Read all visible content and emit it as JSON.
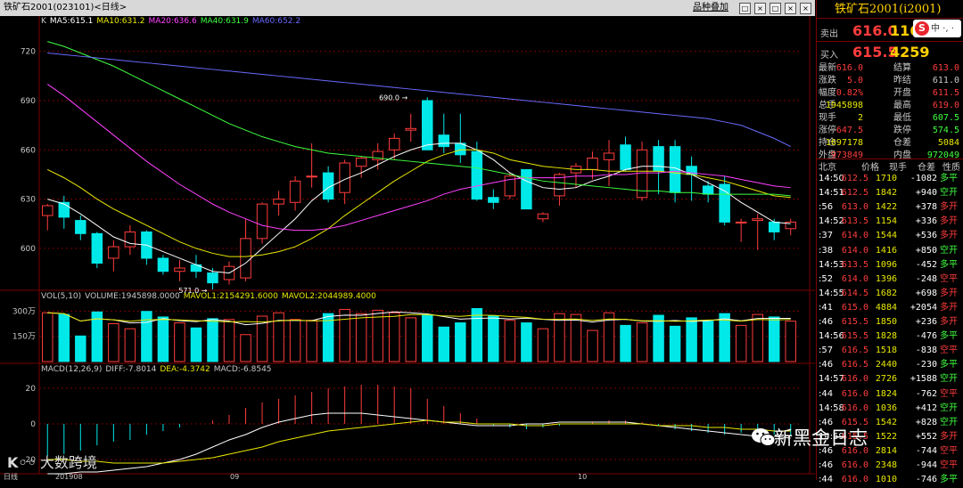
{
  "window": {
    "title": "铁矿石2001(023101)<日线>",
    "toolbar_label": "品种叠加",
    "buttons": [
      "□",
      "×",
      "□",
      "×",
      "×"
    ]
  },
  "ma_line": [
    {
      "text": "K",
      "color": "#c8c8c8"
    },
    {
      "text": "MA5:615.1",
      "color": "#ffffff"
    },
    {
      "text": "MA10:631.2",
      "color": "#e8e800"
    },
    {
      "text": "MA20:636.6",
      "color": "#ff40ff"
    },
    {
      "text": "MA40:631.9",
      "color": "#40ff40"
    },
    {
      "text": "MA60:652.2",
      "color": "#6a6aff"
    }
  ],
  "price_axis": [
    "720",
    "690",
    "660",
    "630",
    "600"
  ],
  "price_annotations": {
    "high": "690.0",
    "low": "571.0"
  },
  "vol_line": [
    {
      "text": "VOL(5,10)",
      "color": "#c8c8c8"
    },
    {
      "text": "VOLUME:1945898.0000",
      "color": "#c8c8c8"
    },
    {
      "text": "MAVOL1:2154291.6000",
      "color": "#e8e800"
    },
    {
      "text": "MAVOL2:2044989.4000",
      "color": "#e8e800"
    }
  ],
  "vol_axis": [
    "300万",
    "150万"
  ],
  "macd_line": [
    {
      "text": "MACD(12,26,9)",
      "color": "#c8c8c8"
    },
    {
      "text": "DIFF:-7.8014",
      "color": "#c8c8c8"
    },
    {
      "text": "DEA:-4.3742",
      "color": "#e8e800"
    },
    {
      "text": "MACD:-6.8545",
      "color": "#c8c8c8"
    }
  ],
  "macd_axis": [
    "20",
    "0",
    "-20"
  ],
  "date_axis": [
    "日线",
    "201908",
    "09",
    "10"
  ],
  "colors": {
    "up": "#ff3c3c",
    "down": "#00e8e8",
    "grid": "#7a0000",
    "neutral": "#c8c8c8"
  },
  "chart_data": {
    "type": "candlestick",
    "price_ylim": [
      575,
      735
    ],
    "candles": [
      {
        "o": 620,
        "h": 627,
        "l": 611,
        "c": 626
      },
      {
        "o": 628,
        "h": 632,
        "l": 612,
        "c": 619
      },
      {
        "o": 617,
        "h": 620,
        "l": 605,
        "c": 609
      },
      {
        "o": 609,
        "h": 610,
        "l": 588,
        "c": 591
      },
      {
        "o": 594,
        "h": 605,
        "l": 586,
        "c": 601
      },
      {
        "o": 601,
        "h": 614,
        "l": 596,
        "c": 610
      },
      {
        "o": 610,
        "h": 611,
        "l": 590,
        "c": 594
      },
      {
        "o": 594,
        "h": 596,
        "l": 584,
        "c": 586
      },
      {
        "o": 586,
        "h": 593,
        "l": 580,
        "c": 588
      },
      {
        "o": 590,
        "h": 596,
        "l": 582,
        "c": 586
      },
      {
        "o": 585,
        "h": 588,
        "l": 575,
        "c": 579
      },
      {
        "o": 581,
        "h": 592,
        "l": 578,
        "c": 589
      },
      {
        "o": 582,
        "h": 618,
        "l": 580,
        "c": 606
      },
      {
        "o": 606,
        "h": 628,
        "l": 603,
        "c": 627
      },
      {
        "o": 627,
        "h": 635,
        "l": 620,
        "c": 630
      },
      {
        "o": 628,
        "h": 644,
        "l": 623,
        "c": 641
      },
      {
        "o": 644,
        "h": 664,
        "l": 637,
        "c": 644
      },
      {
        "o": 646,
        "h": 650,
        "l": 628,
        "c": 630
      },
      {
        "o": 634,
        "h": 654,
        "l": 627,
        "c": 652
      },
      {
        "o": 650,
        "h": 656,
        "l": 643,
        "c": 655
      },
      {
        "o": 654,
        "h": 664,
        "l": 648,
        "c": 659
      },
      {
        "o": 660,
        "h": 670,
        "l": 654,
        "c": 667
      },
      {
        "o": 672,
        "h": 682,
        "l": 665,
        "c": 673
      },
      {
        "o": 690,
        "h": 692,
        "l": 660,
        "c": 660
      },
      {
        "o": 669,
        "h": 682,
        "l": 658,
        "c": 662
      },
      {
        "o": 664,
        "h": 682,
        "l": 652,
        "c": 657
      },
      {
        "o": 659,
        "h": 665,
        "l": 629,
        "c": 630
      },
      {
        "o": 631,
        "h": 636,
        "l": 624,
        "c": 628
      },
      {
        "o": 632,
        "h": 646,
        "l": 630,
        "c": 644
      },
      {
        "o": 648,
        "h": 648,
        "l": 624,
        "c": 624
      },
      {
        "o": 618,
        "h": 622,
        "l": 616,
        "c": 621
      },
      {
        "o": 632,
        "h": 646,
        "l": 626,
        "c": 645
      },
      {
        "o": 646,
        "h": 652,
        "l": 637,
        "c": 650
      },
      {
        "o": 648,
        "h": 659,
        "l": 642,
        "c": 655
      },
      {
        "o": 654,
        "h": 666,
        "l": 638,
        "c": 658
      },
      {
        "o": 663,
        "h": 668,
        "l": 647,
        "c": 648
      },
      {
        "o": 631,
        "h": 665,
        "l": 629,
        "c": 660
      },
      {
        "o": 662,
        "h": 666,
        "l": 633,
        "c": 647
      },
      {
        "o": 662,
        "h": 666,
        "l": 628,
        "c": 634
      },
      {
        "o": 650,
        "h": 656,
        "l": 629,
        "c": 645
      },
      {
        "o": 638,
        "h": 641,
        "l": 628,
        "c": 633
      },
      {
        "o": 639,
        "h": 644,
        "l": 614,
        "c": 616
      },
      {
        "o": 616,
        "h": 618,
        "l": 604,
        "c": 616
      },
      {
        "o": 617,
        "h": 621,
        "l": 599,
        "c": 618
      },
      {
        "o": 616,
        "h": 618,
        "l": 605,
        "c": 610
      },
      {
        "o": 612,
        "h": 618,
        "l": 608,
        "c": 616
      }
    ],
    "ma_lines": {
      "MA5": [
        630,
        627,
        621,
        614,
        607,
        603,
        602,
        598,
        594,
        590,
        586,
        585,
        591,
        600,
        609,
        618,
        629,
        637,
        642,
        646,
        651,
        656,
        660,
        663,
        664,
        664,
        660,
        654,
        646,
        641,
        637,
        636,
        637,
        641,
        644,
        648,
        650,
        650,
        649,
        645,
        640,
        635,
        628,
        622,
        616,
        615
      ],
      "MA10": [
        648,
        643,
        637,
        630,
        624,
        619,
        614,
        609,
        604,
        600,
        597,
        595,
        595,
        596,
        598,
        601,
        606,
        612,
        620,
        627,
        634,
        641,
        647,
        653,
        657,
        660,
        660,
        658,
        654,
        652,
        650,
        649,
        648,
        648,
        647,
        647,
        647,
        647,
        646,
        645,
        643,
        641,
        638,
        635,
        632,
        631
      ],
      "MA20": [
        700,
        693,
        685,
        677,
        669,
        661,
        653,
        646,
        639,
        633,
        627,
        622,
        618,
        614,
        612,
        611,
        611,
        612,
        614,
        617,
        620,
        623,
        626,
        629,
        633,
        636,
        638,
        640,
        642,
        643,
        643,
        643,
        644,
        644,
        645,
        645,
        646,
        646,
        647,
        646,
        645,
        644,
        642,
        640,
        638,
        637
      ],
      "MA40": [
        726,
        723,
        719,
        715,
        711,
        706,
        701,
        696,
        691,
        686,
        681,
        676,
        672,
        668,
        665,
        662,
        660,
        658,
        657,
        656,
        655,
        654,
        653,
        652,
        651,
        650,
        649,
        647,
        645,
        643,
        641,
        640,
        639,
        638,
        637,
        636,
        635,
        635,
        634,
        634,
        633,
        633,
        633,
        633,
        633,
        632
      ],
      "MA60": [
        719,
        718,
        717,
        716,
        715,
        714,
        713,
        712,
        711,
        710,
        709,
        708,
        707,
        706,
        705,
        704,
        703,
        702,
        701,
        700,
        699,
        698,
        697,
        696,
        695,
        694,
        693,
        692,
        691,
        690,
        689,
        688,
        687,
        686,
        685,
        684,
        683,
        682,
        681,
        680,
        679,
        677,
        675,
        671,
        667,
        662
      ]
    },
    "volume_wan": [
      290,
      280,
      152,
      295,
      225,
      195,
      298,
      265,
      230,
      200,
      255,
      250,
      160,
      270,
      290,
      250,
      245,
      285,
      310,
      285,
      305,
      290,
      260,
      275,
      205,
      230,
      315,
      270,
      245,
      230,
      195,
      285,
      280,
      185,
      290,
      215,
      230,
      275,
      210,
      260,
      240,
      285,
      215,
      280,
      265,
      240
    ],
    "vol_ylim": [
      0,
      360
    ],
    "macd_ylim": [
      -28,
      28
    ],
    "macd_hist": [
      -18,
      -17,
      -15,
      -12,
      -10,
      -9,
      -6,
      -4,
      -2,
      0,
      2,
      5,
      9,
      12,
      14,
      16,
      18,
      20,
      21,
      22,
      22,
      21,
      20,
      14,
      10,
      6,
      3,
      -1,
      -2,
      -3,
      -2,
      -1,
      0,
      1,
      2,
      2,
      1,
      -1,
      -3,
      -4,
      -5,
      -6,
      -5,
      -5,
      -6,
      -7
    ],
    "macd_diff": [
      -28,
      -28,
      -27,
      -27,
      -26,
      -25,
      -24,
      -22,
      -20,
      -17,
      -13,
      -9,
      -6,
      -2,
      1,
      3,
      5,
      6,
      6,
      6,
      5,
      4,
      3,
      2,
      1,
      0,
      -1,
      -1,
      -1,
      0,
      0,
      1,
      1,
      1,
      1,
      1,
      0,
      -1,
      -2,
      -3,
      -4,
      -5,
      -6,
      -7,
      -7,
      -8
    ],
    "macd_dea": [
      -20,
      -20,
      -21,
      -21,
      -22,
      -22,
      -22,
      -22,
      -21,
      -20,
      -19,
      -17,
      -15,
      -13,
      -10,
      -8,
      -6,
      -4,
      -3,
      -2,
      -1,
      0,
      1,
      2,
      1,
      1,
      0,
      0,
      0,
      -1,
      -1,
      0,
      0,
      0,
      0,
      0,
      0,
      -1,
      -1,
      -1,
      -2,
      -2,
      -3,
      -3,
      -4,
      -4
    ]
  },
  "quote": {
    "title": "铁矿石2001(i2001)",
    "sell_label": "卖出",
    "sell_price": "616.0",
    "sell_vol": "116",
    "buy_label": "买入",
    "buy_price": "615.5",
    "buy_vol": "4259",
    "stats": [
      {
        "l1": "最新",
        "v1": "616.0",
        "c1": "#ff3c3c",
        "l2": "结算",
        "v2": "613.0",
        "c2": "#ff3c3c"
      },
      {
        "l1": "涨跌",
        "v1": "5.0",
        "c1": "#ff3c3c",
        "l2": "昨结",
        "v2": "611.0",
        "c2": "#c8c8c8"
      },
      {
        "l1": "幅度",
        "v1": "0.82%",
        "c1": "#ff3c3c",
        "l2": "开盘",
        "v2": "611.5",
        "c2": "#ff3c3c"
      },
      {
        "l1": "总手",
        "v1": "1945898",
        "c1": "#e8e800",
        "l2": "最高",
        "v2": "619.0",
        "c2": "#ff3c3c"
      },
      {
        "l1": "现手",
        "v1": "2",
        "c1": "#e8e800",
        "l2": "最低",
        "v2": "607.5",
        "c2": "#40ff40"
      },
      {
        "l1": "涨停",
        "v1": "647.5",
        "c1": "#ff3c3c",
        "l2": "跌停",
        "v2": "574.5",
        "c2": "#40ff40"
      },
      {
        "l1": "持仓",
        "v1": "1697178",
        "c1": "#e8e800",
        "l2": "仓差",
        "v2": "5084",
        "c2": "#e8e800"
      },
      {
        "l1": "外盘",
        "v1": "973849",
        "c1": "#ff3c3c",
        "l2": "内盘",
        "v2": "972049",
        "c2": "#40ff40"
      }
    ],
    "tick_headers": [
      "北京",
      "价格",
      "现手",
      "仓差",
      "性质"
    ],
    "ticks": [
      {
        "t": "14:50",
        "p": "612.5",
        "v": "1710",
        "d": "-1082",
        "n": "多平",
        "nc": "#40ff40"
      },
      {
        "t": "14:51",
        "p": "612.5",
        "v": "1842",
        "d": "+940",
        "n": "空开",
        "nc": "#40ff40"
      },
      {
        "t": ":56",
        "p": "613.0",
        "v": "1422",
        "d": "+378",
        "n": "多开",
        "nc": "#ff3c3c"
      },
      {
        "t": "14:52",
        "p": "613.5",
        "v": "1154",
        "d": "+336",
        "n": "多开",
        "nc": "#ff3c3c"
      },
      {
        "t": ":37",
        "p": "614.0",
        "v": "1544",
        "d": "+536",
        "n": "多开",
        "nc": "#ff3c3c"
      },
      {
        "t": ":38",
        "p": "614.0",
        "v": "1416",
        "d": "+850",
        "n": "空开",
        "nc": "#40ff40"
      },
      {
        "t": "14:53",
        "p": "613.5",
        "v": "1096",
        "d": "-452",
        "n": "多平",
        "nc": "#40ff40"
      },
      {
        "t": ":52",
        "p": "614.0",
        "v": "1396",
        "d": "-248",
        "n": "空平",
        "nc": "#ff3c3c"
      },
      {
        "t": "14:55",
        "p": "614.5",
        "v": "1682",
        "d": "+698",
        "n": "多开",
        "nc": "#ff3c3c"
      },
      {
        "t": ":41",
        "p": "615.0",
        "v": "4884",
        "d": "+2054",
        "n": "多开",
        "nc": "#ff3c3c"
      },
      {
        "t": ":46",
        "p": "615.5",
        "v": "1850",
        "d": "+236",
        "n": "多开",
        "nc": "#ff3c3c"
      },
      {
        "t": "14:56",
        "p": "615.5",
        "v": "1828",
        "d": "-476",
        "n": "多平",
        "nc": "#40ff40"
      },
      {
        "t": ":57",
        "p": "616.5",
        "v": "1518",
        "d": "-838",
        "n": "空平",
        "nc": "#ff3c3c"
      },
      {
        "t": ":46",
        "p": "616.5",
        "v": "2440",
        "d": "-230",
        "n": "多平",
        "nc": "#40ff40"
      },
      {
        "t": "14:57",
        "p": "616.0",
        "v": "2726",
        "d": "+1588",
        "n": "空开",
        "nc": "#40ff40"
      },
      {
        "t": ":44",
        "p": "616.0",
        "v": "1824",
        "d": "-762",
        "n": "空平",
        "nc": "#ff3c3c"
      },
      {
        "t": "14:58",
        "p": "616.0",
        "v": "1036",
        "d": "+412",
        "n": "空开",
        "nc": "#40ff40"
      },
      {
        "t": ":46",
        "p": "615.5",
        "v": "1542",
        "d": "+828",
        "n": "空开",
        "nc": "#40ff40"
      },
      {
        "t": "14:59",
        "p": "615.5",
        "v": "1522",
        "d": "+552",
        "n": "多开",
        "nc": "#ff3c3c"
      },
      {
        "t": ":46",
        "p": "616.0",
        "v": "2814",
        "d": "-744",
        "n": "空平",
        "nc": "#ff3c3c"
      },
      {
        "t": ":46",
        "p": "616.0",
        "v": "2348",
        "d": "-944",
        "n": "空平",
        "nc": "#ff3c3c"
      },
      {
        "t": ":44",
        "p": "616.0",
        "v": "1010",
        "d": "-746",
        "n": "多平",
        "nc": "#40ff40"
      }
    ]
  },
  "overlay": {
    "badge_s": "S",
    "badge_text": "中 ·, ·",
    "watermark_left": "大数跨境",
    "watermark_right": "新黑金日志"
  }
}
